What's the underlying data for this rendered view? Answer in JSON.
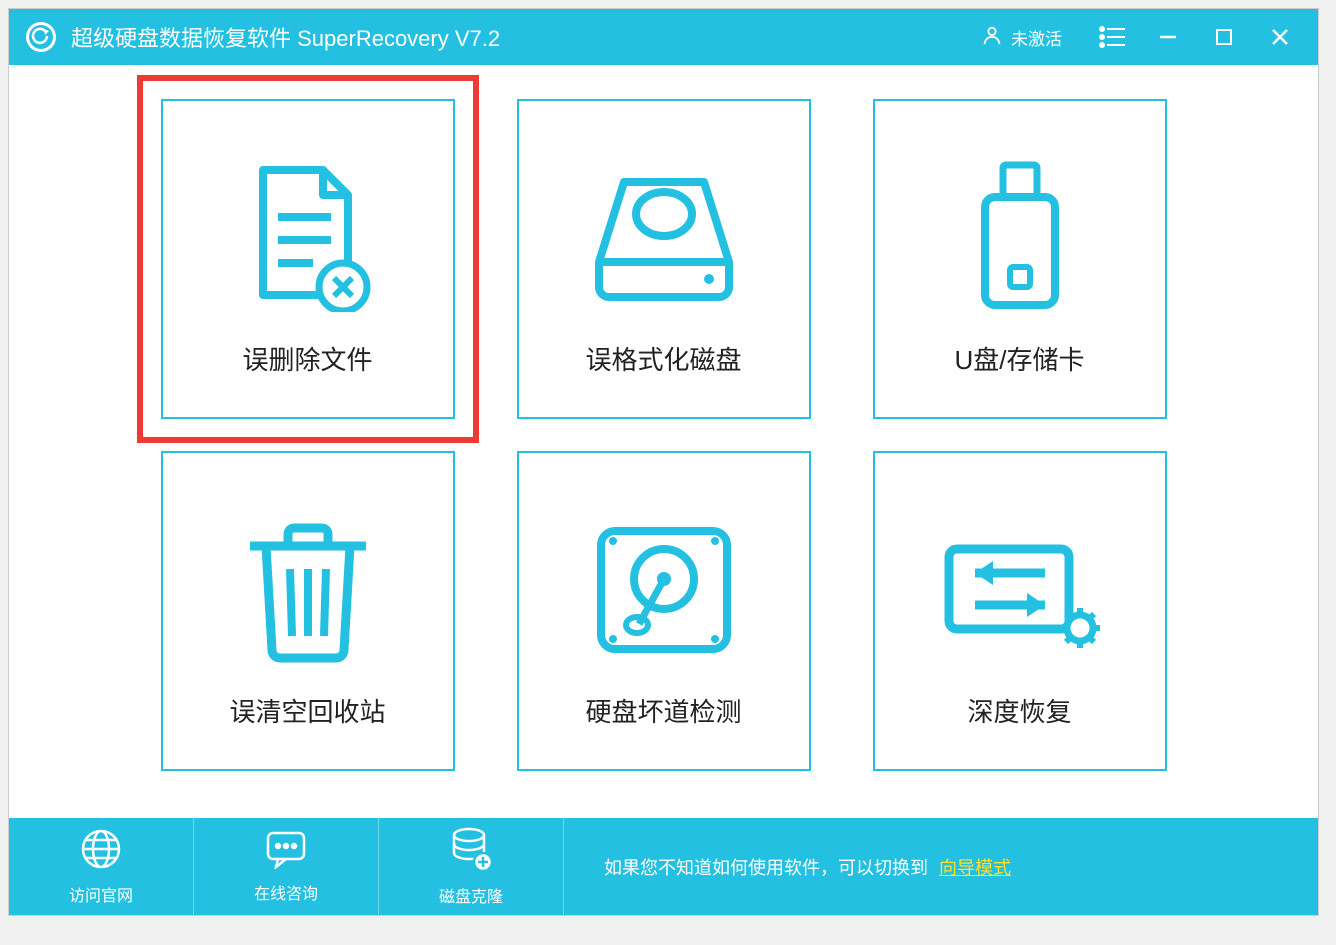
{
  "titlebar": {
    "app_title": "超级硬盘数据恢复软件 SuperRecovery V7.2",
    "user_status": "未激活"
  },
  "options": [
    {
      "label": "误删除文件",
      "icon": "document-delete-icon",
      "highlighted": true
    },
    {
      "label": "误格式化磁盘",
      "icon": "drive-scan-icon",
      "highlighted": false
    },
    {
      "label": "U盘/存储卡",
      "icon": "usb-icon",
      "highlighted": false
    },
    {
      "label": "误清空回收站",
      "icon": "trash-icon",
      "highlighted": false
    },
    {
      "label": "硬盘坏道检测",
      "icon": "disk-check-icon",
      "highlighted": false
    },
    {
      "label": "深度恢复",
      "icon": "deep-recover-icon",
      "highlighted": false
    }
  ],
  "footer": {
    "buttons": [
      {
        "label": "访问官网",
        "icon": "globe-icon"
      },
      {
        "label": "在线咨询",
        "icon": "chat-icon"
      },
      {
        "label": "磁盘克隆",
        "icon": "disk-clone-icon"
      }
    ],
    "hint_prefix": "如果您不知道如何使用软件，可以切换到",
    "hint_link": "向导模式"
  },
  "colors": {
    "accent": "#24c0e2",
    "highlight": "#ed3b33",
    "link": "#ffe028"
  }
}
